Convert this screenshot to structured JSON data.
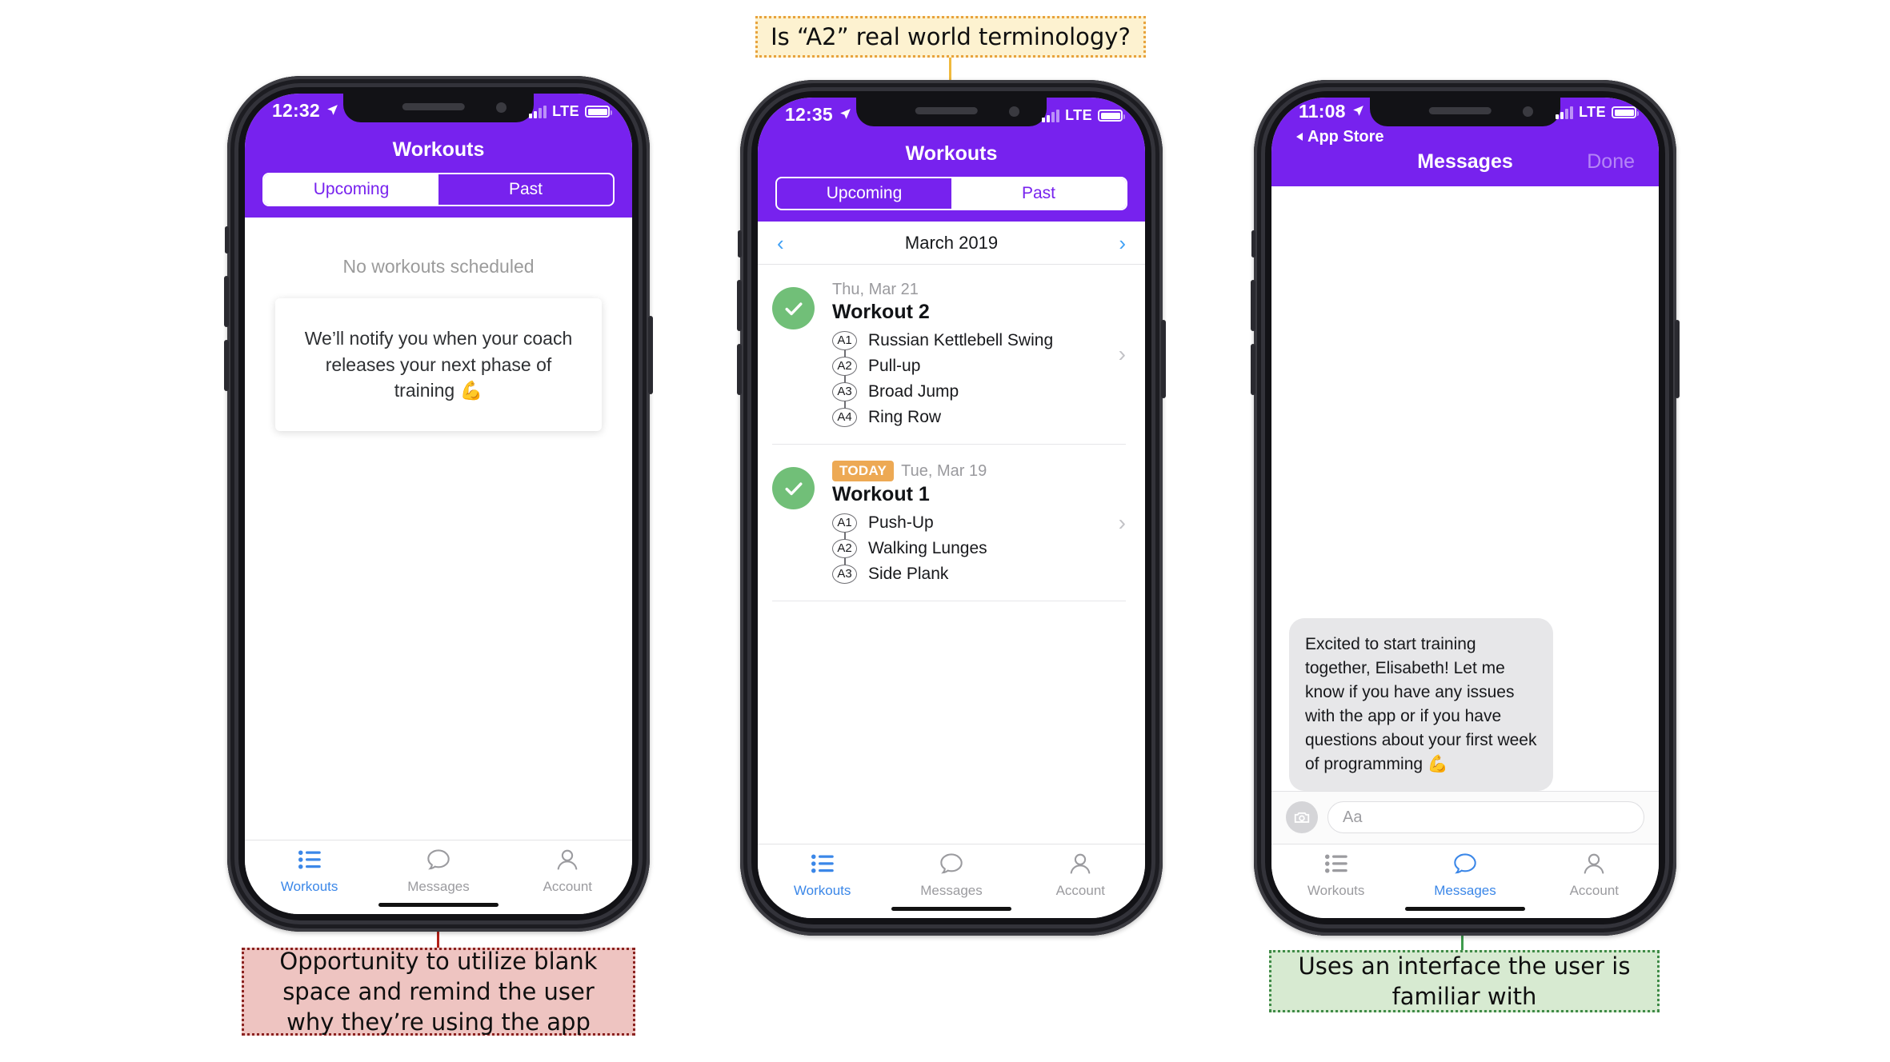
{
  "annotations": [
    {
      "id": "a2-terminology",
      "text": "Is “A2” real world terminology?",
      "color": "#e8a33d",
      "fill": "#fdf2d0"
    },
    {
      "id": "blank-space",
      "text": "Opportunity to utilize blank space and remind the user why they’re using the app",
      "color": "#8b2220",
      "fill": "#eec4c1"
    },
    {
      "id": "familiar-interface",
      "text": "Uses an interface the user is familiar with",
      "color": "#3f8b47",
      "fill": "#d7ead1"
    }
  ],
  "theme": {
    "purple": "#7722ee",
    "accent_blue": "#3b87e8",
    "green_check": "#71bf78",
    "today_orange": "#eda954",
    "marker_red": "#b32018",
    "marker_yellow": "#f0b93c",
    "marker_green": "#3f9b4d"
  },
  "phone1": {
    "status": {
      "time": "12:32",
      "location_icon": "location-arrow-icon",
      "carrier": "LTE",
      "signal_icon": "signal-bars-icon",
      "battery_icon": "battery-icon"
    },
    "nav": {
      "title": "Workouts"
    },
    "segments": [
      {
        "label": "Upcoming",
        "selected": true
      },
      {
        "label": "Past",
        "selected": false
      }
    ],
    "empty_state": "No workouts scheduled",
    "notify_card": "We’ll notify you when your coach releases your next phase of training 💪",
    "tabs": [
      {
        "label": "Workouts",
        "icon": "list-icon",
        "active": true
      },
      {
        "label": "Messages",
        "icon": "chat-bubble-icon",
        "active": false
      },
      {
        "label": "Account",
        "icon": "person-icon",
        "active": false
      }
    ]
  },
  "phone2": {
    "status": {
      "time": "12:35",
      "location_icon": "location-arrow-icon",
      "carrier": "LTE",
      "signal_icon": "signal-bars-icon",
      "battery_icon": "battery-icon"
    },
    "nav": {
      "title": "Workouts"
    },
    "segments": [
      {
        "label": "Upcoming",
        "selected": false
      },
      {
        "label": "Past",
        "selected": true
      }
    ],
    "month": {
      "prev_icon": "chevron-left-icon",
      "label": "March 2019",
      "next_icon": "chevron-right-icon"
    },
    "workouts": [
      {
        "date": "Thu, Mar 21",
        "badge": "",
        "name": "Workout 2",
        "completed": true,
        "exercises": [
          {
            "code": "A1",
            "name": "Russian Kettlebell Swing"
          },
          {
            "code": "A2",
            "name": "Pull-up"
          },
          {
            "code": "A3",
            "name": "Broad Jump"
          },
          {
            "code": "A4",
            "name": "Ring Row"
          }
        ]
      },
      {
        "date": "Tue, Mar 19",
        "badge": "TODAY",
        "name": "Workout 1",
        "completed": true,
        "exercises": [
          {
            "code": "A1",
            "name": "Push-Up"
          },
          {
            "code": "A2",
            "name": "Walking Lunges"
          },
          {
            "code": "A3",
            "name": "Side Plank"
          }
        ]
      }
    ],
    "tabs": [
      {
        "label": "Workouts",
        "icon": "list-icon",
        "active": true
      },
      {
        "label": "Messages",
        "icon": "chat-bubble-icon",
        "active": false
      },
      {
        "label": "Account",
        "icon": "person-icon",
        "active": false
      }
    ]
  },
  "phone3": {
    "status": {
      "time": "11:08",
      "location_icon": "location-arrow-icon",
      "back_label": "App Store",
      "carrier": "LTE",
      "signal_icon": "signal-bars-icon",
      "battery_icon": "battery-icon"
    },
    "nav": {
      "title": "Messages",
      "done_label": "Done"
    },
    "messages": [
      {
        "from": "coach",
        "text": "Excited to start training together, Elisabeth! Let me know if you have any issues with the app or if you have questions about your first week of programming 💪"
      }
    ],
    "composer": {
      "camera_icon": "camera-icon",
      "placeholder": "Aa",
      "value": ""
    },
    "tabs": [
      {
        "label": "Workouts",
        "icon": "list-icon",
        "active": false
      },
      {
        "label": "Messages",
        "icon": "chat-bubble-icon",
        "active": true
      },
      {
        "label": "Account",
        "icon": "person-icon",
        "active": false
      }
    ]
  }
}
